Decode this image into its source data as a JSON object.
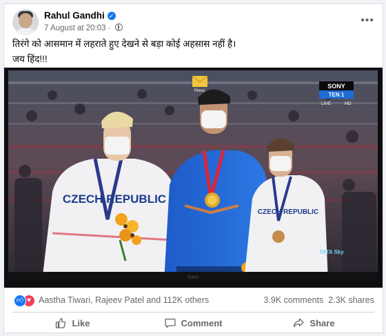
{
  "post": {
    "author": "Rahul Gandhi",
    "date": "7 August at 20:03",
    "privacy_icon": "globe-icon",
    "verified_icon": "verified-badge-icon",
    "text_line1": "तिरंगे को आसमान में लहराते हुए देखने से बड़ा कोई अहसास नहीं है।",
    "text_line2": "जय हिंद!!!"
  },
  "media": {
    "scoreboard_network": "SONY",
    "scoreboard_channel": "TEN 1",
    "scoreboard_live": "LIVE",
    "scoreboard_hd": "HD",
    "envelope_label": "Press",
    "bib_left": "CZECH REPUBLIC",
    "bib_right": "CZECH REPUBLIC",
    "tv_brand": "SONY",
    "sponsor": "TATA Sky"
  },
  "reactions": {
    "icons": [
      "like-icon",
      "love-icon"
    ],
    "summary": "Aastha Tiwari, Rajeev Patel and 112K others",
    "comments": "3.9K comments",
    "shares": "2.3K shares"
  },
  "actions": {
    "like": "Like",
    "comment": "Comment",
    "share": "Share"
  },
  "colors": {
    "fb_blue": "#1877f2",
    "love_red": "#f33e58",
    "secondary_text": "#65676b"
  }
}
